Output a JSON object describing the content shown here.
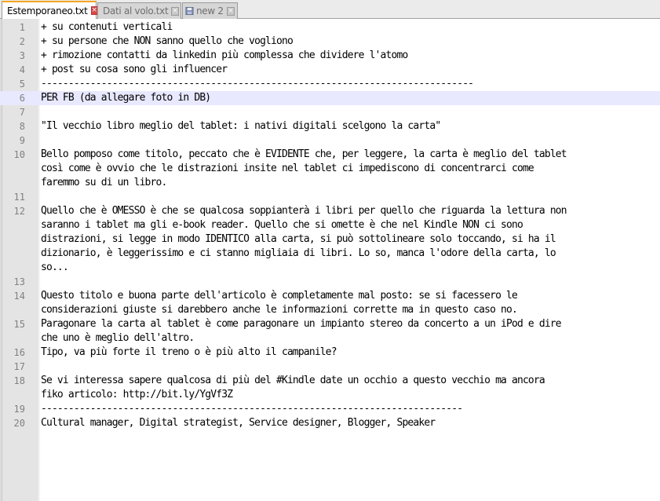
{
  "tabs": [
    {
      "label": "Estemporaneo.txt",
      "active": true,
      "icon": "file-saved-icon"
    },
    {
      "label": "Dati al volo.txt",
      "active": false,
      "icon": "file-icon"
    },
    {
      "label": "new  2",
      "active": false,
      "icon": "file-icon"
    }
  ],
  "editor": {
    "current_line": 6,
    "rows": [
      {
        "n": "1",
        "t": "+ su contenuti verticali"
      },
      {
        "n": "2",
        "t": "+ su persone che NON sanno quello che vogliono"
      },
      {
        "n": "3",
        "t": "+ rimozione contatti da linkedin più complessa che dividere l'atomo"
      },
      {
        "n": "4",
        "t": "+ post su cosa sono gli influencer"
      },
      {
        "n": "5",
        "t": "-------------------------------------------------------------------------------"
      },
      {
        "n": "6",
        "t": "PER FB (da allegare foto in DB)"
      },
      {
        "n": "7",
        "t": ""
      },
      {
        "n": "8",
        "t": "\"Il vecchio libro meglio del tablet: i nativi digitali scelgono la carta\""
      },
      {
        "n": "9",
        "t": ""
      },
      {
        "n": "10",
        "t": "Bello pomposo come titolo, peccato che è EVIDENTE che, per leggere, la carta è meglio del tablet"
      },
      {
        "n": "",
        "t": "così come è ovvio che le distrazioni insite nel tablet ci impediscono di concentrarci come"
      },
      {
        "n": "",
        "t": "faremmo su di un libro."
      },
      {
        "n": "11",
        "t": ""
      },
      {
        "n": "12",
        "t": "Quello che è OMESSO è che se qualcosa soppianterà i libri per quello che riguarda la lettura non"
      },
      {
        "n": "",
        "t": "saranno i tablet ma gli e-book reader. Quello che si omette è che nel Kindle NON ci sono"
      },
      {
        "n": "",
        "t": "distrazioni, si legge in modo IDENTICO alla carta, si può sottolineare solo toccando, si ha il"
      },
      {
        "n": "",
        "t": "dizionario, è leggerissimo e ci stanno migliaia di libri. Lo so, manca l'odore della carta, lo"
      },
      {
        "n": "",
        "t": "so..."
      },
      {
        "n": "13",
        "t": ""
      },
      {
        "n": "14",
        "t": "Questo titolo e buona parte dell'articolo è completamente mal posto: se si facessero le"
      },
      {
        "n": "",
        "t": "considerazioni giuste si darebbero anche le informazioni corrette ma in questo caso no."
      },
      {
        "n": "15",
        "t": "Paragonare la carta al tablet è come paragonare un impianto stereo da concerto a un iPod e dire"
      },
      {
        "n": "",
        "t": "che uno è meglio dell'altro."
      },
      {
        "n": "16",
        "t": "Tipo, va più forte il treno o è più alto il campanile?"
      },
      {
        "n": "17",
        "t": ""
      },
      {
        "n": "18",
        "t": "Se vi interessa sapere qualcosa di più del #Kindle date un occhio a questo vecchio ma ancora"
      },
      {
        "n": "",
        "t": "fiko articolo: http://bit.ly/YgVf3Z"
      },
      {
        "n": "19",
        "t": "-----------------------------------------------------------------------------"
      },
      {
        "n": "20",
        "t": "Cultural manager, Digital strategist, Service designer, Blogger, Speaker"
      }
    ]
  },
  "colors": {
    "gutter": "#e4e4e4",
    "current_line": "#e8e8ff",
    "tab_accent": "#f5a623",
    "spell_underline": "#ff0000"
  }
}
